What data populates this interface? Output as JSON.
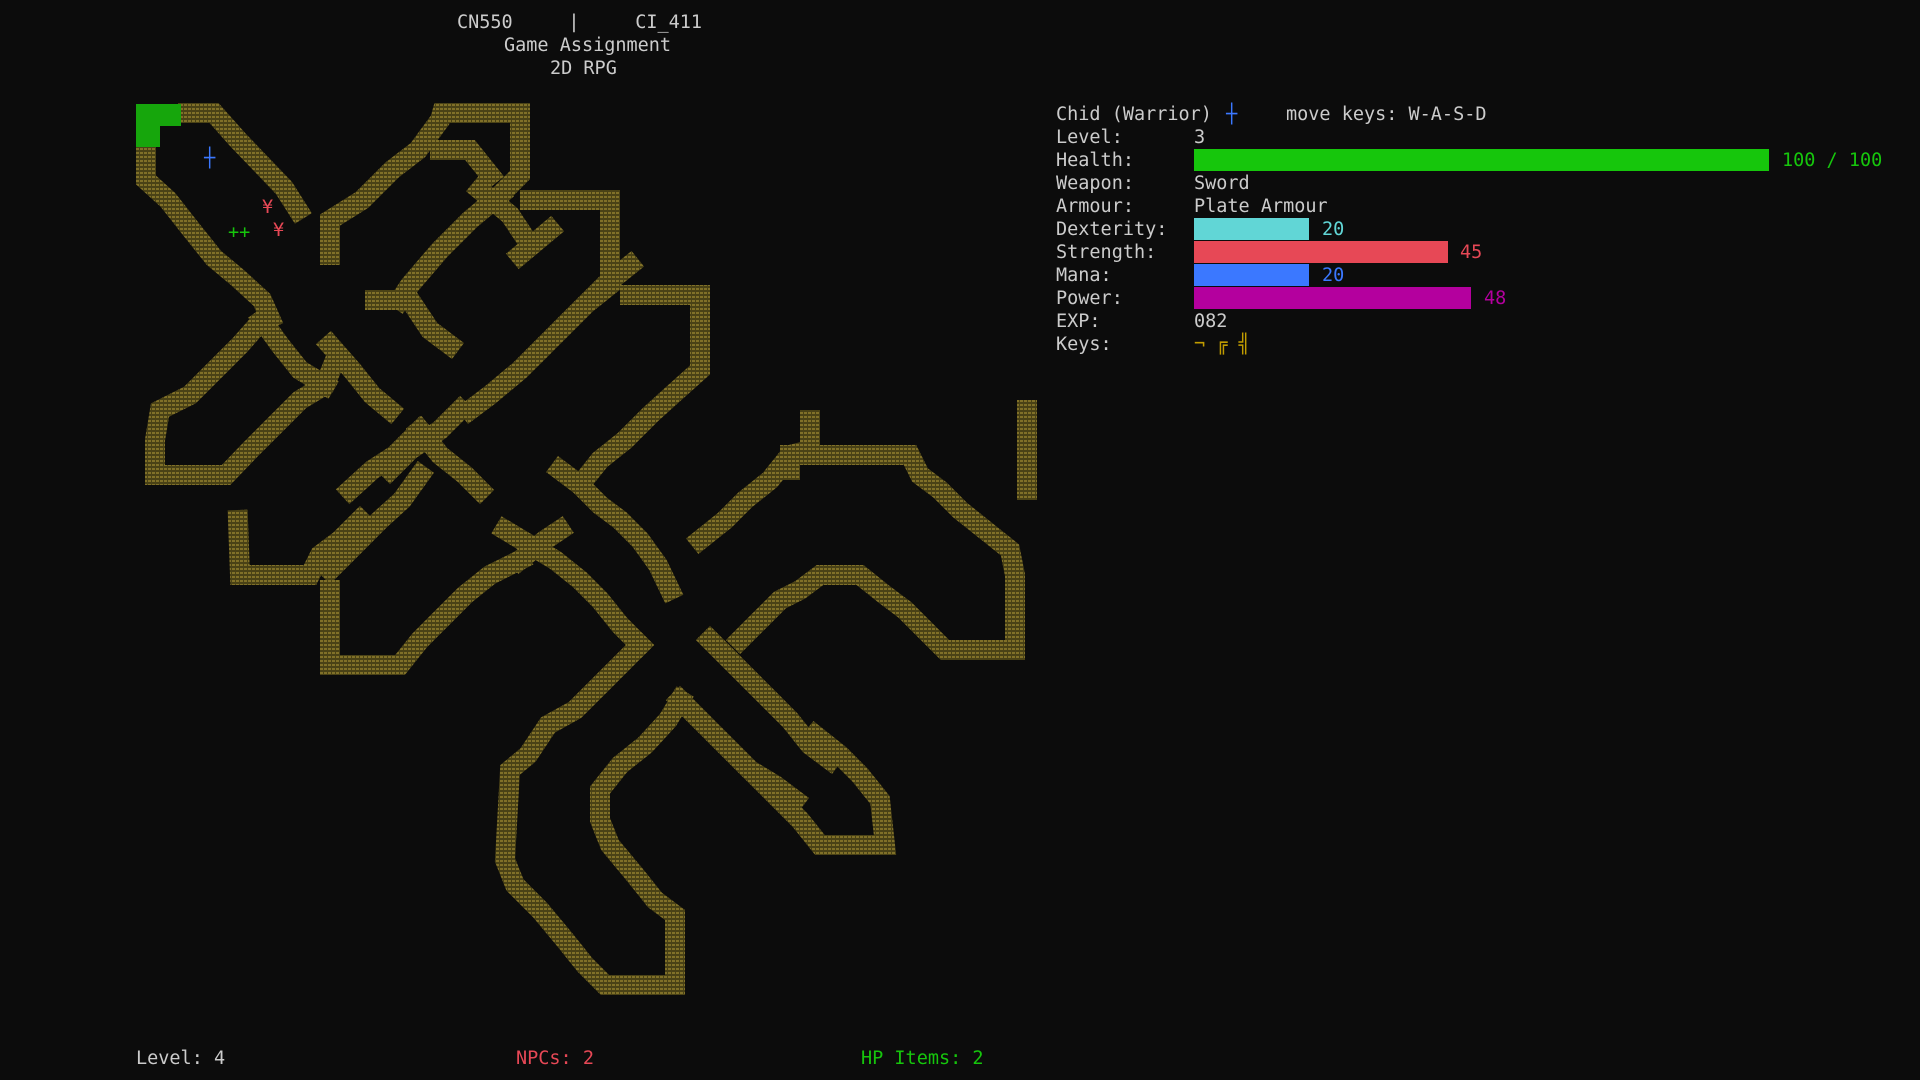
{
  "header": {
    "course_line": "CN550     |     CI_411",
    "assignment": "Game Assignment",
    "game_title": "2D RPG"
  },
  "colors": {
    "wall": "#807028",
    "health": "#16c60c",
    "dexterity": "#61d6d6",
    "strength": "#e74856",
    "mana": "#3b78ff",
    "power": "#b4009e",
    "player": "#3b78ff",
    "npc": "#e74856",
    "hp_item": "#16c60c",
    "key": "#c19c00",
    "text": "#cccccc"
  },
  "player": {
    "name_class": "Chid (Warrior)",
    "glyph": "┼",
    "move_keys": "move keys: W-A-S-D"
  },
  "stats": {
    "level_label": "Level:",
    "level_value": "3",
    "health_label": "Health:",
    "health_text": "100 / 100",
    "health_current": 100,
    "health_max": 100,
    "weapon_label": "Weapon:",
    "weapon_value": "Sword",
    "armour_label": "Armour:",
    "armour_value": "Plate Armour",
    "dexterity_label": "Dexterity:",
    "dexterity_value": "20",
    "strength_label": "Strength:",
    "strength_value": "45",
    "mana_label": "Mana:",
    "mana_value": "20",
    "power_label": "Power:",
    "power_value": "48",
    "exp_label": "EXP:",
    "exp_value": "082",
    "keys_label": "Keys:",
    "keys_value": "¬ ╔ ╣"
  },
  "map_glyphs": {
    "player": "┼",
    "npc": "¥",
    "hp_item": "++"
  },
  "footer": {
    "level": "Level: 4",
    "npcs": "NPCs: 2",
    "hp_items": "HP Items: 2"
  }
}
